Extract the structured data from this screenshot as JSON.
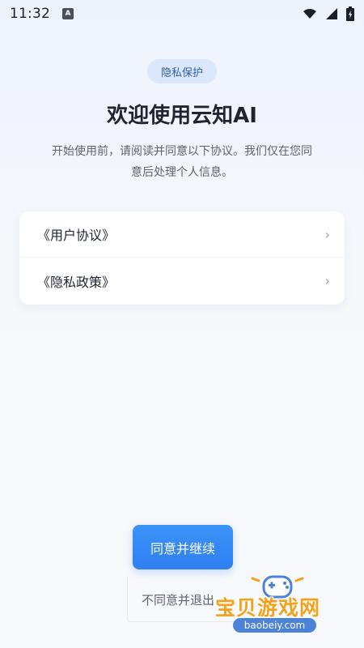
{
  "status_bar": {
    "time": "11:32",
    "notification_letter": "A",
    "icons": [
      "notification-a-icon",
      "wifi-icon",
      "signal-icon",
      "battery-icon"
    ]
  },
  "page": {
    "badge": "隐私保护",
    "title": "欢迎使用云知AI",
    "subtitle": "开始使用前，请阅读并同意以下协议。我们仅在您同意后处理个人信息。"
  },
  "agreements": [
    {
      "label": "《用户协议》",
      "icon": "chevron-right-icon"
    },
    {
      "label": "《隐私政策》",
      "icon": "chevron-right-icon"
    }
  ],
  "actions": {
    "agree_label": "同意并继续",
    "disagree_label": "不同意并退出"
  },
  "watermark": {
    "title": "宝贝游戏网",
    "domain": "baobeiy.com"
  },
  "colors": {
    "primary": "#2f7ff2",
    "badge_bg": "#dbe7fb",
    "badge_text": "#2f5fae",
    "watermark": "#f4a21d"
  }
}
